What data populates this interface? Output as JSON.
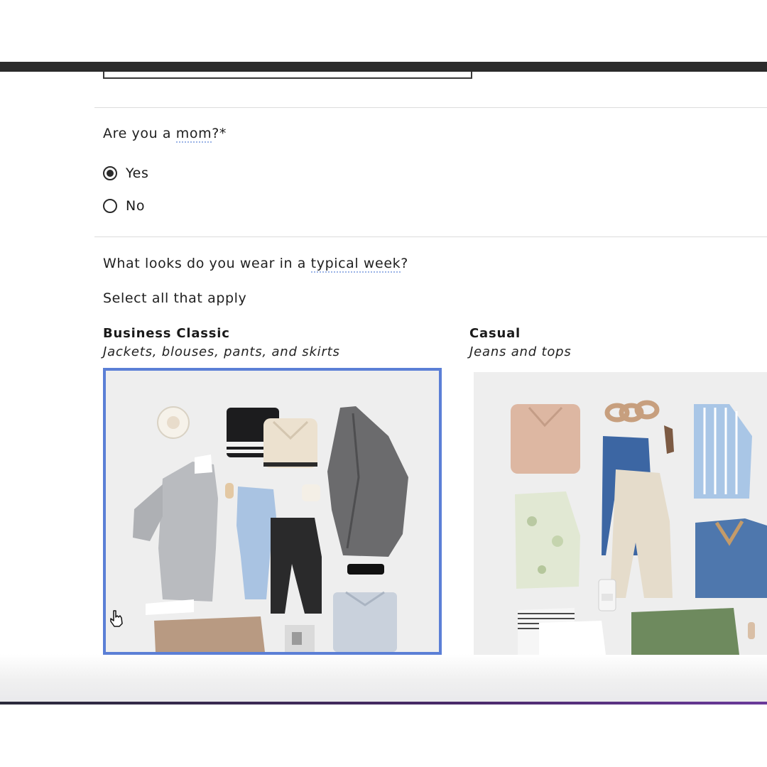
{
  "mom_question": {
    "text_before": "Are you a ",
    "term": "mom",
    "text_after": "?*",
    "options": [
      {
        "label": "Yes",
        "selected": true
      },
      {
        "label": "No",
        "selected": false
      }
    ]
  },
  "looks_question": {
    "text_before": "What looks do you wear in a ",
    "term": "typical week",
    "text_after": "?",
    "hint": "Select all that apply",
    "options": [
      {
        "title": "Business Classic",
        "subtitle": "Jackets, blouses, pants, and skirts",
        "selected": true
      },
      {
        "title": "Casual",
        "subtitle": "Jeans and tops",
        "selected": false
      }
    ]
  },
  "colors": {
    "selected_border": "#5b7fd6",
    "term_underline": "#9bb3e6",
    "divider": "#dcdcdc"
  }
}
